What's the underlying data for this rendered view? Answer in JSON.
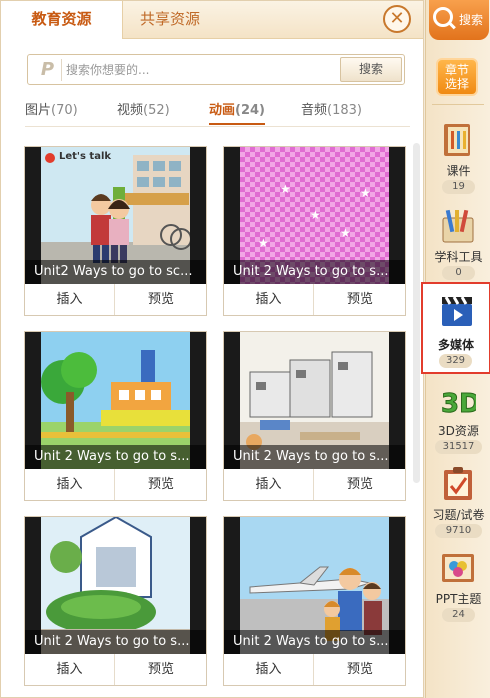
{
  "tabs": {
    "education": "教育资源",
    "shared": "共享资源"
  },
  "search": {
    "placeholder": "搜索你想要的...",
    "button": "搜索"
  },
  "categories": [
    {
      "label": "图片",
      "count": "(70)"
    },
    {
      "label": "视频",
      "count": "(52)"
    },
    {
      "label": "动画",
      "count": "(24)"
    },
    {
      "label": "音频",
      "count": "(183)"
    }
  ],
  "active_category": "动画",
  "cards": [
    {
      "title": "Unit2 Ways to go to sc...",
      "thumb_text": "Let's talk",
      "insert": "插入",
      "preview": "预览"
    },
    {
      "title": "Unit 2 Ways to go to s...",
      "insert": "插入",
      "preview": "预览"
    },
    {
      "title": "Unit 2 Ways to go to s...",
      "insert": "插入",
      "preview": "预览"
    },
    {
      "title": "Unit 2 Ways to go to s...",
      "insert": "插入",
      "preview": "预览"
    },
    {
      "title": "Unit 2 Ways to go to s...",
      "insert": "插入",
      "preview": "预览"
    },
    {
      "title": "Unit 2 Ways to go to s...",
      "insert": "插入",
      "preview": "预览"
    }
  ],
  "sidebar": {
    "search_label": "搜索",
    "chapter_label_1": "章节",
    "chapter_label_2": "选择",
    "items": [
      {
        "label": "课件",
        "count": "19",
        "icon": "courseware-icon"
      },
      {
        "label": "学科工具",
        "count": "0",
        "icon": "subject-tools-icon"
      },
      {
        "label": "多媒体",
        "count": "329",
        "icon": "multimedia-clapper-icon"
      },
      {
        "label": "3D资源",
        "count": "31517",
        "icon": "3d-icon"
      },
      {
        "label": "习题/试卷",
        "count": "9710",
        "icon": "exercise-icon"
      },
      {
        "label": "PPT主题",
        "count": "24",
        "icon": "ppt-theme-icon"
      }
    ],
    "selected": "多媒体"
  },
  "colors": {
    "accent": "#c85a12",
    "selected_outline": "#e23c2c",
    "sidebar_bg": "#f4e3c6"
  }
}
